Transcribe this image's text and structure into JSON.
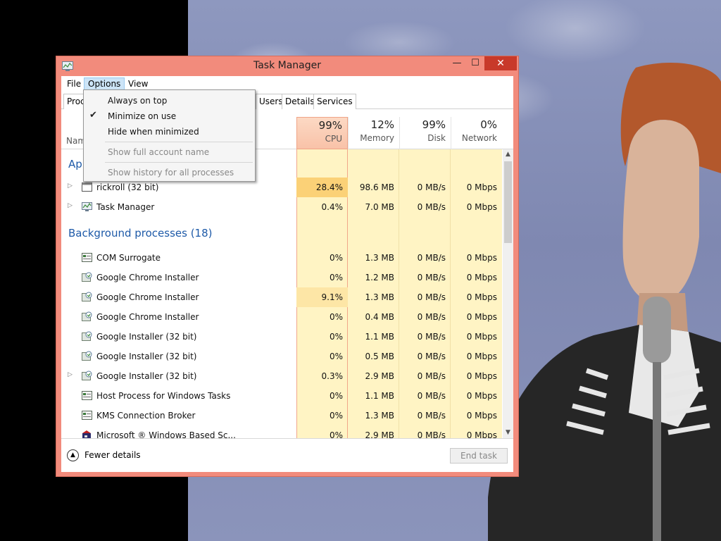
{
  "window": {
    "title": "Task Manager"
  },
  "menubar": {
    "file": "File",
    "options": "Options",
    "view": "View"
  },
  "tabs": {
    "processes": "Proc",
    "users": "Users",
    "details": "Details",
    "services": "Services"
  },
  "columns": {
    "name": "Nam",
    "cpu": {
      "percent": "99%",
      "label": "CPU"
    },
    "memory": {
      "percent": "12%",
      "label": "Memory"
    },
    "disk": {
      "percent": "99%",
      "label": "Disk"
    },
    "network": {
      "percent": "0%",
      "label": "Network"
    }
  },
  "groups": {
    "apps": "App",
    "background": "Background processes (18)"
  },
  "processes": [
    {
      "name": "rickroll (32 bit)",
      "cpu": "28.4%",
      "memory": "98.6 MB",
      "disk": "0 MB/s",
      "network": "0 Mbps",
      "expandable": true,
      "icon": "app-window-icon"
    },
    {
      "name": "Task Manager",
      "cpu": "0.4%",
      "memory": "7.0 MB",
      "disk": "0 MB/s",
      "network": "0 Mbps",
      "expandable": true,
      "icon": "task-manager-icon"
    },
    {
      "name": "COM Surrogate",
      "cpu": "0%",
      "memory": "1.3 MB",
      "disk": "0 MB/s",
      "network": "0 Mbps",
      "expandable": false,
      "icon": "service-window-icon"
    },
    {
      "name": "Google Chrome Installer",
      "cpu": "0%",
      "memory": "1.2 MB",
      "disk": "0 MB/s",
      "network": "0 Mbps",
      "expandable": false,
      "icon": "installer-icon"
    },
    {
      "name": "Google Chrome Installer",
      "cpu": "9.1%",
      "memory": "1.3 MB",
      "disk": "0 MB/s",
      "network": "0 Mbps",
      "expandable": false,
      "icon": "installer-icon"
    },
    {
      "name": "Google Chrome Installer",
      "cpu": "0%",
      "memory": "0.4 MB",
      "disk": "0 MB/s",
      "network": "0 Mbps",
      "expandable": false,
      "icon": "installer-icon"
    },
    {
      "name": "Google Installer (32 bit)",
      "cpu": "0%",
      "memory": "1.1 MB",
      "disk": "0 MB/s",
      "network": "0 Mbps",
      "expandable": false,
      "icon": "installer-icon"
    },
    {
      "name": "Google Installer (32 bit)",
      "cpu": "0%",
      "memory": "0.5 MB",
      "disk": "0 MB/s",
      "network": "0 Mbps",
      "expandable": false,
      "icon": "installer-icon"
    },
    {
      "name": "Google Installer (32 bit)",
      "cpu": "0.3%",
      "memory": "2.9 MB",
      "disk": "0 MB/s",
      "network": "0 Mbps",
      "expandable": true,
      "icon": "installer-icon"
    },
    {
      "name": "Host Process for Windows Tasks",
      "cpu": "0%",
      "memory": "1.1 MB",
      "disk": "0 MB/s",
      "network": "0 Mbps",
      "expandable": false,
      "icon": "service-window-icon"
    },
    {
      "name": "KMS Connection Broker",
      "cpu": "0%",
      "memory": "1.3 MB",
      "disk": "0 MB/s",
      "network": "0 Mbps",
      "expandable": false,
      "icon": "service-window-icon"
    },
    {
      "name": "Microsoft ® Windows Based Sc...",
      "cpu": "0%",
      "memory": "2.9 MB",
      "disk": "0 MB/s",
      "network": "0 Mbps",
      "expandable": false,
      "icon": "script-host-icon"
    }
  ],
  "options_menu": {
    "always_on_top": "Always on top",
    "minimize_on_use": "Minimize on use",
    "hide_when_minimized": "Hide when minimized",
    "show_full_account_name": "Show full account name",
    "show_history": "Show history for all processes",
    "checked": "minimize_on_use"
  },
  "footer": {
    "fewer_details": "Fewer details",
    "end_task": "End task"
  },
  "colors": {
    "window_frame": "#f28b7c",
    "close_button": "#c8392a",
    "heat_light": "#fff4c4",
    "heat_medium": "#fde6a6",
    "heat_strong": "#fbd177",
    "group_header": "#1e5aa8"
  }
}
